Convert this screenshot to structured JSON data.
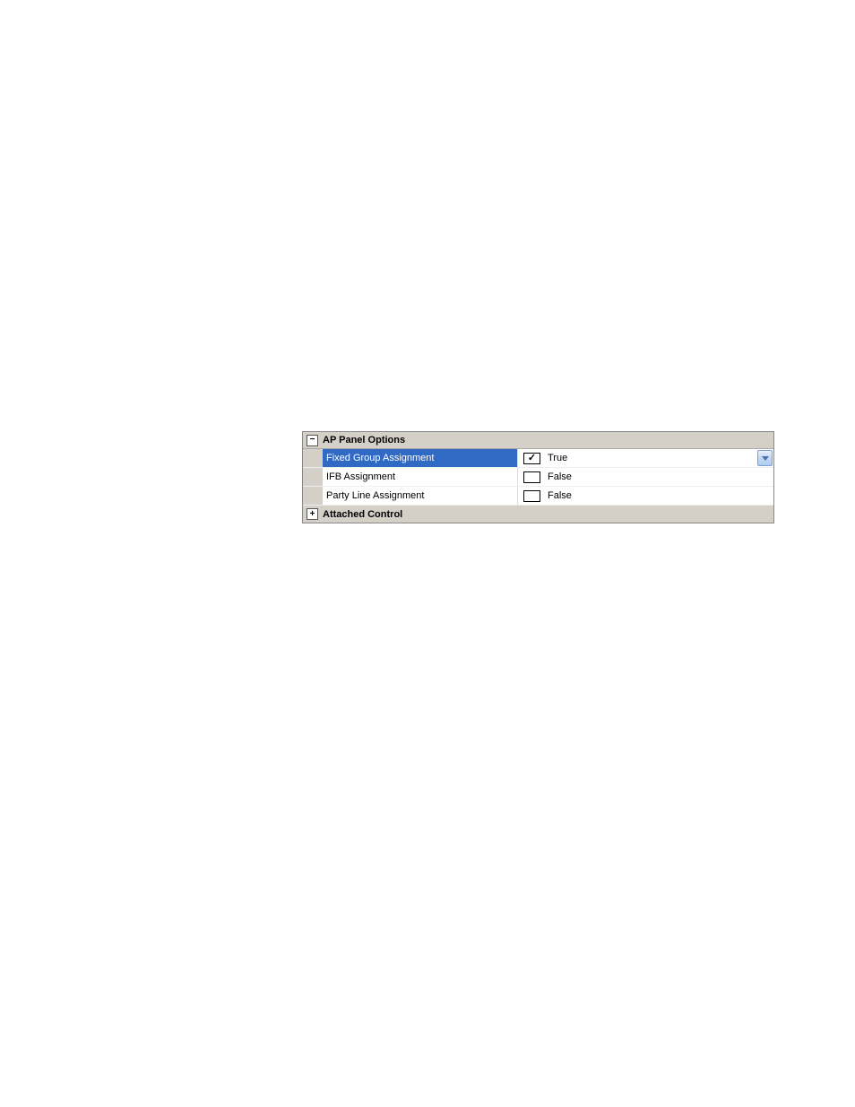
{
  "groups": [
    {
      "title": "AP Panel Options",
      "expanded": true,
      "expand_symbol": "−"
    },
    {
      "title": "Attached Control",
      "expanded": false,
      "expand_symbol": "+"
    }
  ],
  "properties": [
    {
      "name": "Fixed Group Assignment",
      "value": "True",
      "checked": true,
      "selected": true,
      "has_dropdown": true
    },
    {
      "name": "IFB Assignment",
      "value": "False",
      "checked": false,
      "selected": false,
      "has_dropdown": false
    },
    {
      "name": "Party Line Assignment",
      "value": "False",
      "checked": false,
      "selected": false,
      "has_dropdown": false
    }
  ]
}
